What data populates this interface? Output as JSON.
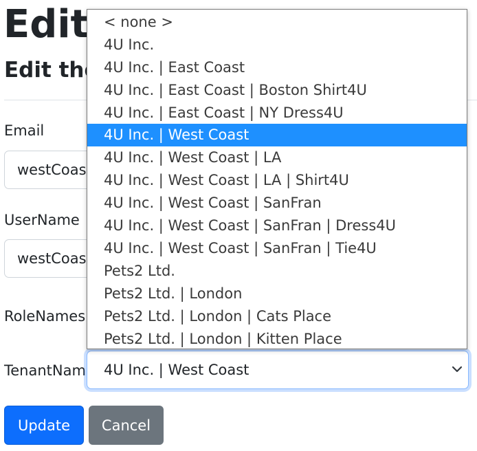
{
  "page": {
    "title": "Edit",
    "subtitle": "Edit the"
  },
  "form": {
    "email_label": "Email",
    "email_value": "westCoast",
    "username_label": "UserName",
    "username_value": "westCoast",
    "rolenames_label": "RoleNames",
    "tenantname_label": "TenantName",
    "tenantname_selected": "4U Inc. | West Coast"
  },
  "dropdown": {
    "selected_index": 4,
    "options": [
      "< none >",
      "4U Inc.",
      "4U Inc. | East Coast",
      "4U Inc. | East Coast | Boston Shirt4U",
      "4U Inc. | East Coast | NY Dress4U",
      "4U Inc. | West Coast",
      "4U Inc. | West Coast | LA",
      "4U Inc. | West Coast | LA | Shirt4U",
      "4U Inc. | West Coast | SanFran",
      "4U Inc. | West Coast | SanFran | Dress4U",
      "4U Inc. | West Coast | SanFran | Tie4U",
      "Pets2 Ltd.",
      "Pets2 Ltd. | London",
      "Pets2 Ltd. | London | Cats Place",
      "Pets2 Ltd. | London | Kitten Place"
    ]
  },
  "buttons": {
    "update_label": "Update",
    "cancel_label": "Cancel"
  },
  "colors": {
    "primary": "#0d6efd",
    "secondary": "#6c757d",
    "highlight": "#1e90ff",
    "focus_border": "#86b7fe"
  }
}
